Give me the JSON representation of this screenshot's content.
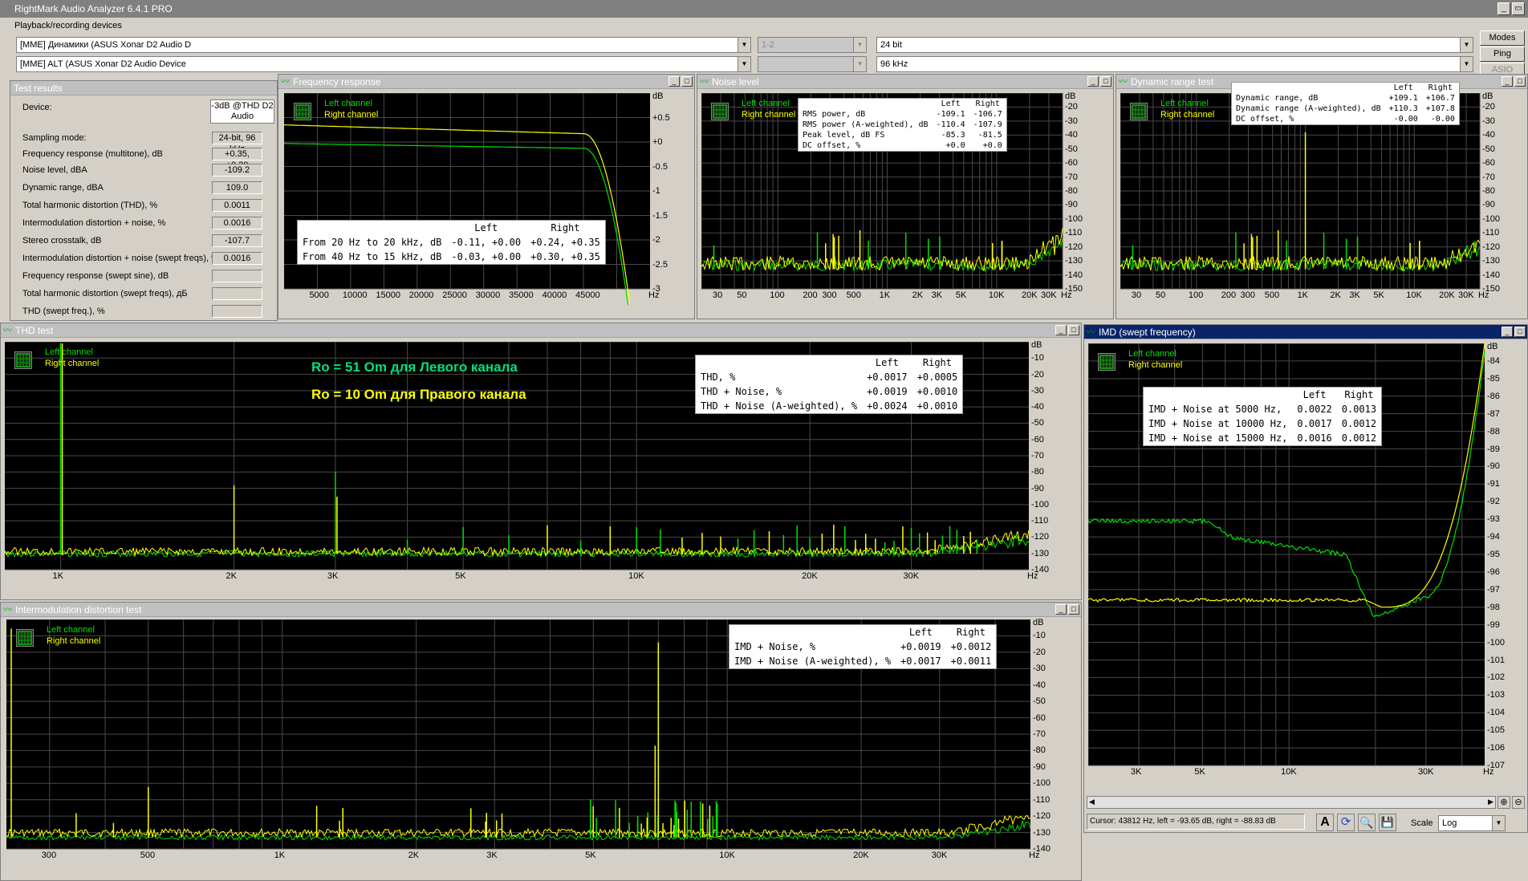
{
  "app": {
    "title": "RightMark Audio Analyzer 6.4.1 PRO"
  },
  "devices": {
    "group_label": "Playback/recording devices",
    "playback": "[MME] Динамики (ASUS Xonar D2 Audio D",
    "recording": "[MME] ALT (ASUS Xonar D2 Audio Device",
    "channels": "1-2",
    "bit_depth": "24 bit",
    "sample_rate": "96 kHz"
  },
  "side_buttons": {
    "modes": "Modes",
    "ping": "Ping",
    "asio": "ASIO"
  },
  "test_results": {
    "title": "Test results",
    "device_label": "Device:",
    "device_value": "-3dB @THD D2 Audio",
    "rows": [
      {
        "label": "Sampling mode:",
        "value": "24-bit, 96 kHz"
      },
      {
        "label": "Frequency response (multitone), dB",
        "value": "+0.35, +0.30"
      },
      {
        "label": "Noise level, dBA",
        "value": "-109.2"
      },
      {
        "label": "Dynamic range, dBA",
        "value": "109.0"
      },
      {
        "label": "Total harmonic distortion (THD), %",
        "value": "0.0011"
      },
      {
        "label": "Intermodulation distortion + noise, %",
        "value": "0.0016"
      },
      {
        "label": "Stereo crosstalk, dB",
        "value": "-107.7"
      },
      {
        "label": "Intermodulation distortion + noise (swept freqs), %",
        "value": "0.0016"
      },
      {
        "label": "Frequency response (swept sine), dB",
        "value": ""
      },
      {
        "label": "Total harmonic distortion (swept freqs), дБ",
        "value": ""
      },
      {
        "label": "THD (swept freq.), %",
        "value": ""
      }
    ]
  },
  "legend": {
    "left": "Left channel",
    "right": "Right channel"
  },
  "freq_resp": {
    "title": "Frequency response",
    "table": {
      "head": [
        "",
        "Left",
        "Right"
      ],
      "rows": [
        [
          "From 20 Hz to 20 kHz, dB",
          "-0.11, +0.00",
          "+0.24, +0.35"
        ],
        [
          "From 40 Hz to 15 kHz, dB",
          "-0.03, +0.00",
          "+0.30, +0.35"
        ]
      ]
    },
    "xticks": [
      "5000",
      "10000",
      "15000",
      "20000",
      "25000",
      "30000",
      "35000",
      "40000",
      "45000",
      "Hz"
    ],
    "yticks": [
      "dB",
      "+0.5",
      "+0",
      "-0.5",
      "-1",
      "-1.5",
      "-2",
      "-2.5",
      "-3"
    ]
  },
  "noise": {
    "title": "Noise level",
    "table": {
      "head": [
        "",
        "Left",
        "Right"
      ],
      "rows": [
        [
          "RMS power, dB",
          "-109.1",
          "-106.7"
        ],
        [
          "RMS power (A-weighted), dB",
          "-110.4",
          "-107.9"
        ],
        [
          "Peak level, dB FS",
          "-85.3",
          "-81.5"
        ],
        [
          "DC offset, %",
          "+0.0",
          "+0.0"
        ]
      ]
    },
    "xticks": [
      "30",
      "50",
      "100",
      "200",
      "300",
      "500",
      "1K",
      "2K",
      "3K",
      "5K",
      "10K",
      "20K",
      "30K",
      "Hz"
    ],
    "yticks": [
      "dB",
      "-20",
      "-30",
      "-40",
      "-50",
      "-60",
      "-70",
      "-80",
      "-90",
      "-100",
      "-110",
      "-120",
      "-130",
      "-140",
      "-150"
    ]
  },
  "dynrange": {
    "title": "Dynamic range test",
    "table": {
      "head": [
        "",
        "Left",
        "Right"
      ],
      "rows": [
        [
          "Dynamic range, dB",
          "+109.1",
          "+106.7"
        ],
        [
          "Dynamic range (A-weighted), dB",
          "+110.3",
          "+107.8"
        ],
        [
          "DC offset, %",
          "-0.00",
          "-0.00"
        ]
      ]
    },
    "xticks": [
      "30",
      "50",
      "100",
      "200",
      "300",
      "500",
      "1K",
      "2K",
      "3K",
      "5K",
      "10K",
      "20K",
      "30K",
      "Hz"
    ],
    "yticks": [
      "dB",
      "-20",
      "-30",
      "-40",
      "-50",
      "-60",
      "-70",
      "-80",
      "-90",
      "-100",
      "-110",
      "-120",
      "-130",
      "-140",
      "-150"
    ]
  },
  "thd": {
    "title": "THD test",
    "annotation_left": "Ro = 51 Om для Левого канала",
    "annotation_right": "Ro = 10 Om для Правого канала",
    "table": {
      "head": [
        "",
        "Left",
        "Right"
      ],
      "rows": [
        [
          "THD, %",
          "+0.0017",
          "+0.0005"
        ],
        [
          "THD + Noise, %",
          "+0.0019",
          "+0.0010"
        ],
        [
          "THD + Noise (A-weighted), %",
          "+0.0024",
          "+0.0010"
        ]
      ]
    },
    "xticks": [
      "1K",
      "2K",
      "3K",
      "5K",
      "10K",
      "20K",
      "30K",
      "Hz"
    ],
    "yticks": [
      "dB",
      "-10",
      "-20",
      "-30",
      "-40",
      "-50",
      "-60",
      "-70",
      "-80",
      "-90",
      "-100",
      "-110",
      "-120",
      "-130",
      "-140"
    ]
  },
  "imd_swept": {
    "title": "IMD (swept frequency)",
    "table": {
      "head": [
        "",
        "Left",
        "Right"
      ],
      "rows": [
        [
          "IMD + Noise at 5000 Hz,",
          "0.0022",
          "0.0013"
        ],
        [
          "IMD + Noise at 10000 Hz,",
          "0.0017",
          "0.0012"
        ],
        [
          "IMD + Noise at 15000 Hz,",
          "0.0016",
          "0.0012"
        ]
      ]
    },
    "xticks": [
      "3K",
      "5K",
      "10K",
      "30K",
      "Hz"
    ],
    "yticks": [
      "dB",
      "-84",
      "-85",
      "-86",
      "-87",
      "-88",
      "-89",
      "-90",
      "-91",
      "-92",
      "-93",
      "-94",
      "-95",
      "-96",
      "-97",
      "-98",
      "-99",
      "-100",
      "-101",
      "-102",
      "-103",
      "-104",
      "-105",
      "-106",
      "-107"
    ],
    "cursor": "Cursor:  43812 Hz,  left = -93.65 dB,  right = -88.83 dB",
    "scale_label": "Scale",
    "scale_value": "Log"
  },
  "imd": {
    "title": "Intermodulation distortion test",
    "table": {
      "head": [
        "",
        "Left",
        "Right"
      ],
      "rows": [
        [
          "IMD + Noise, %",
          "+0.0019",
          "+0.0012"
        ],
        [
          "IMD + Noise (A-weighted), %",
          "+0.0017",
          "+0.0011"
        ]
      ]
    },
    "xticks": [
      "300",
      "500",
      "1K",
      "2K",
      "3K",
      "5K",
      "10K",
      "20K",
      "30K",
      "Hz"
    ],
    "yticks": [
      "dB",
      "-10",
      "-20",
      "-30",
      "-40",
      "-50",
      "-60",
      "-70",
      "-80",
      "-90",
      "-100",
      "-110",
      "-120",
      "-130",
      "-140"
    ]
  },
  "colors": {
    "left": "#00e000",
    "right": "#ffff00",
    "grid": "#3a5a3a",
    "bg": "#000000"
  }
}
